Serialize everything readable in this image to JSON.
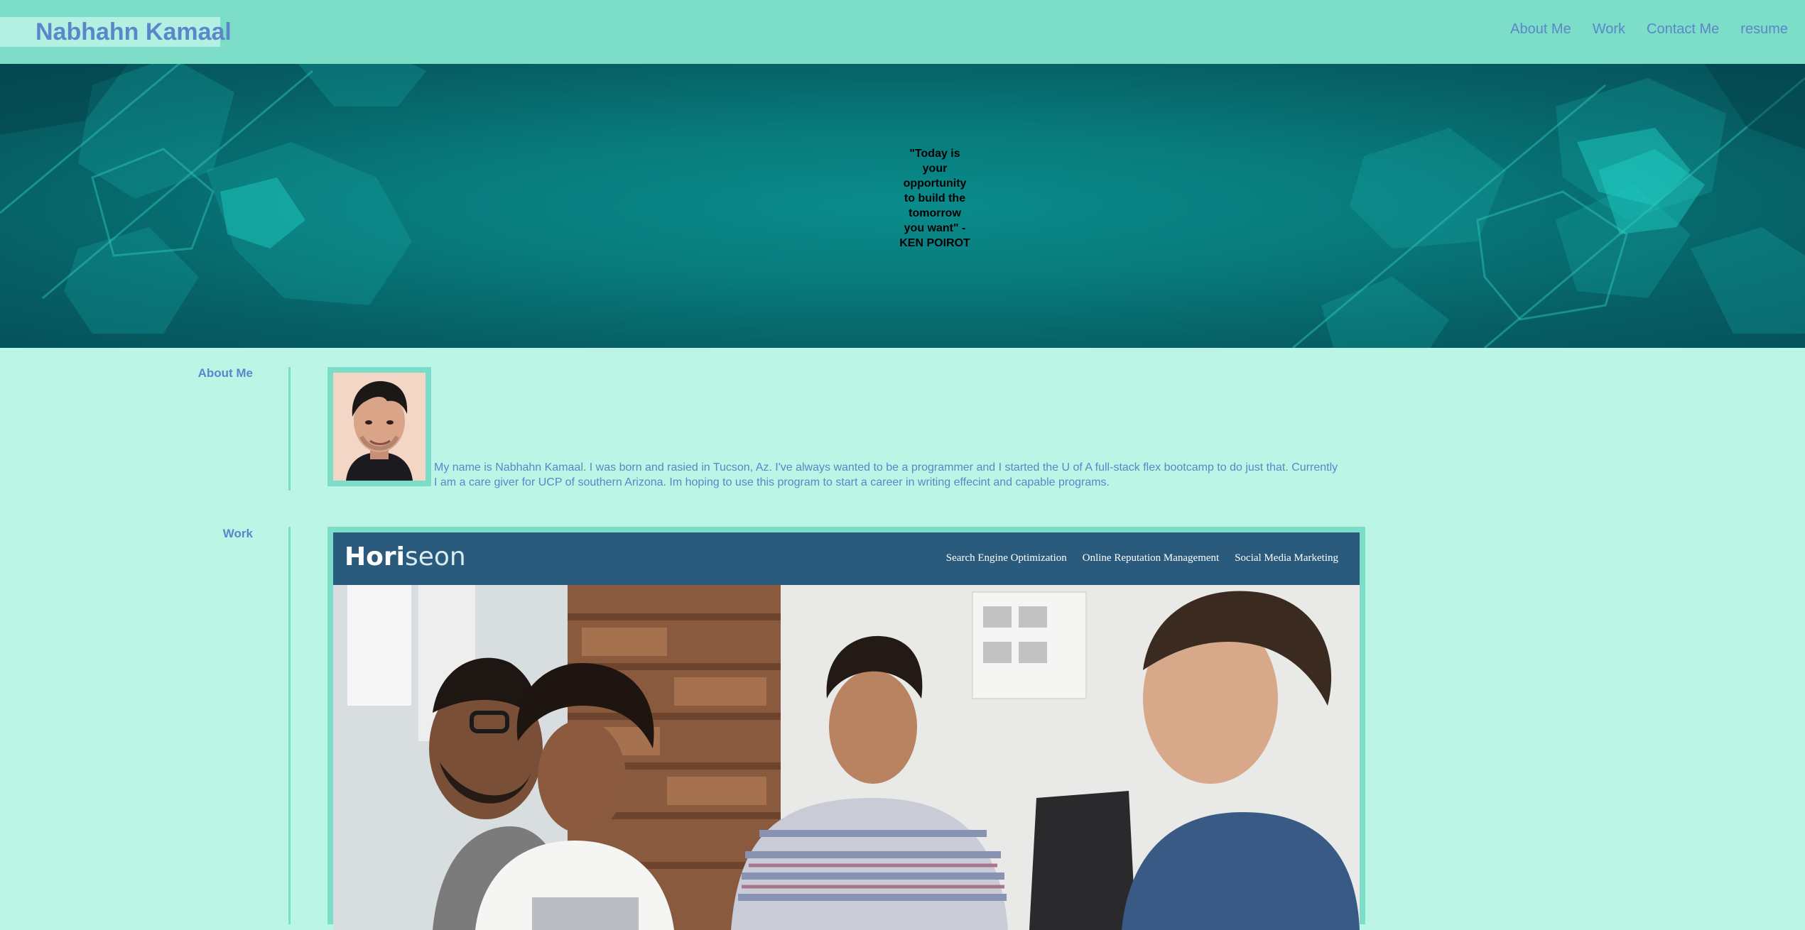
{
  "header": {
    "brand": "Nabhahn Kamaal",
    "nav": [
      "About Me",
      "Work",
      "Contact Me",
      "resume"
    ]
  },
  "hero": {
    "quote": "\"Today is your opportunity to build the tomorrow you want\" - KEN POIROT"
  },
  "about": {
    "label": "About Me",
    "text": "My name is Nabhahn Kamaal. I was born and rasied in Tucson, Az. I've always wanted to be a programmer and I started the U of A full-stack flex bootcamp to do just that. Currently I am a care giver for UCP of southern Arizona. Im hoping to use this program to start a career in writing effecint and capable programs."
  },
  "work": {
    "label": "Work",
    "project": {
      "logo_main": "Hori",
      "logo_accent": "seon",
      "nav": [
        "Search Engine Optimization",
        "Online Reputation Management",
        "Social Media Marketing"
      ]
    }
  },
  "colors": {
    "page_bg": "#baf5e6",
    "header_bg": "#7cdec8",
    "link": "#5b86c9",
    "hero_teal": "#08797b",
    "project_header": "#2b5b7c"
  }
}
